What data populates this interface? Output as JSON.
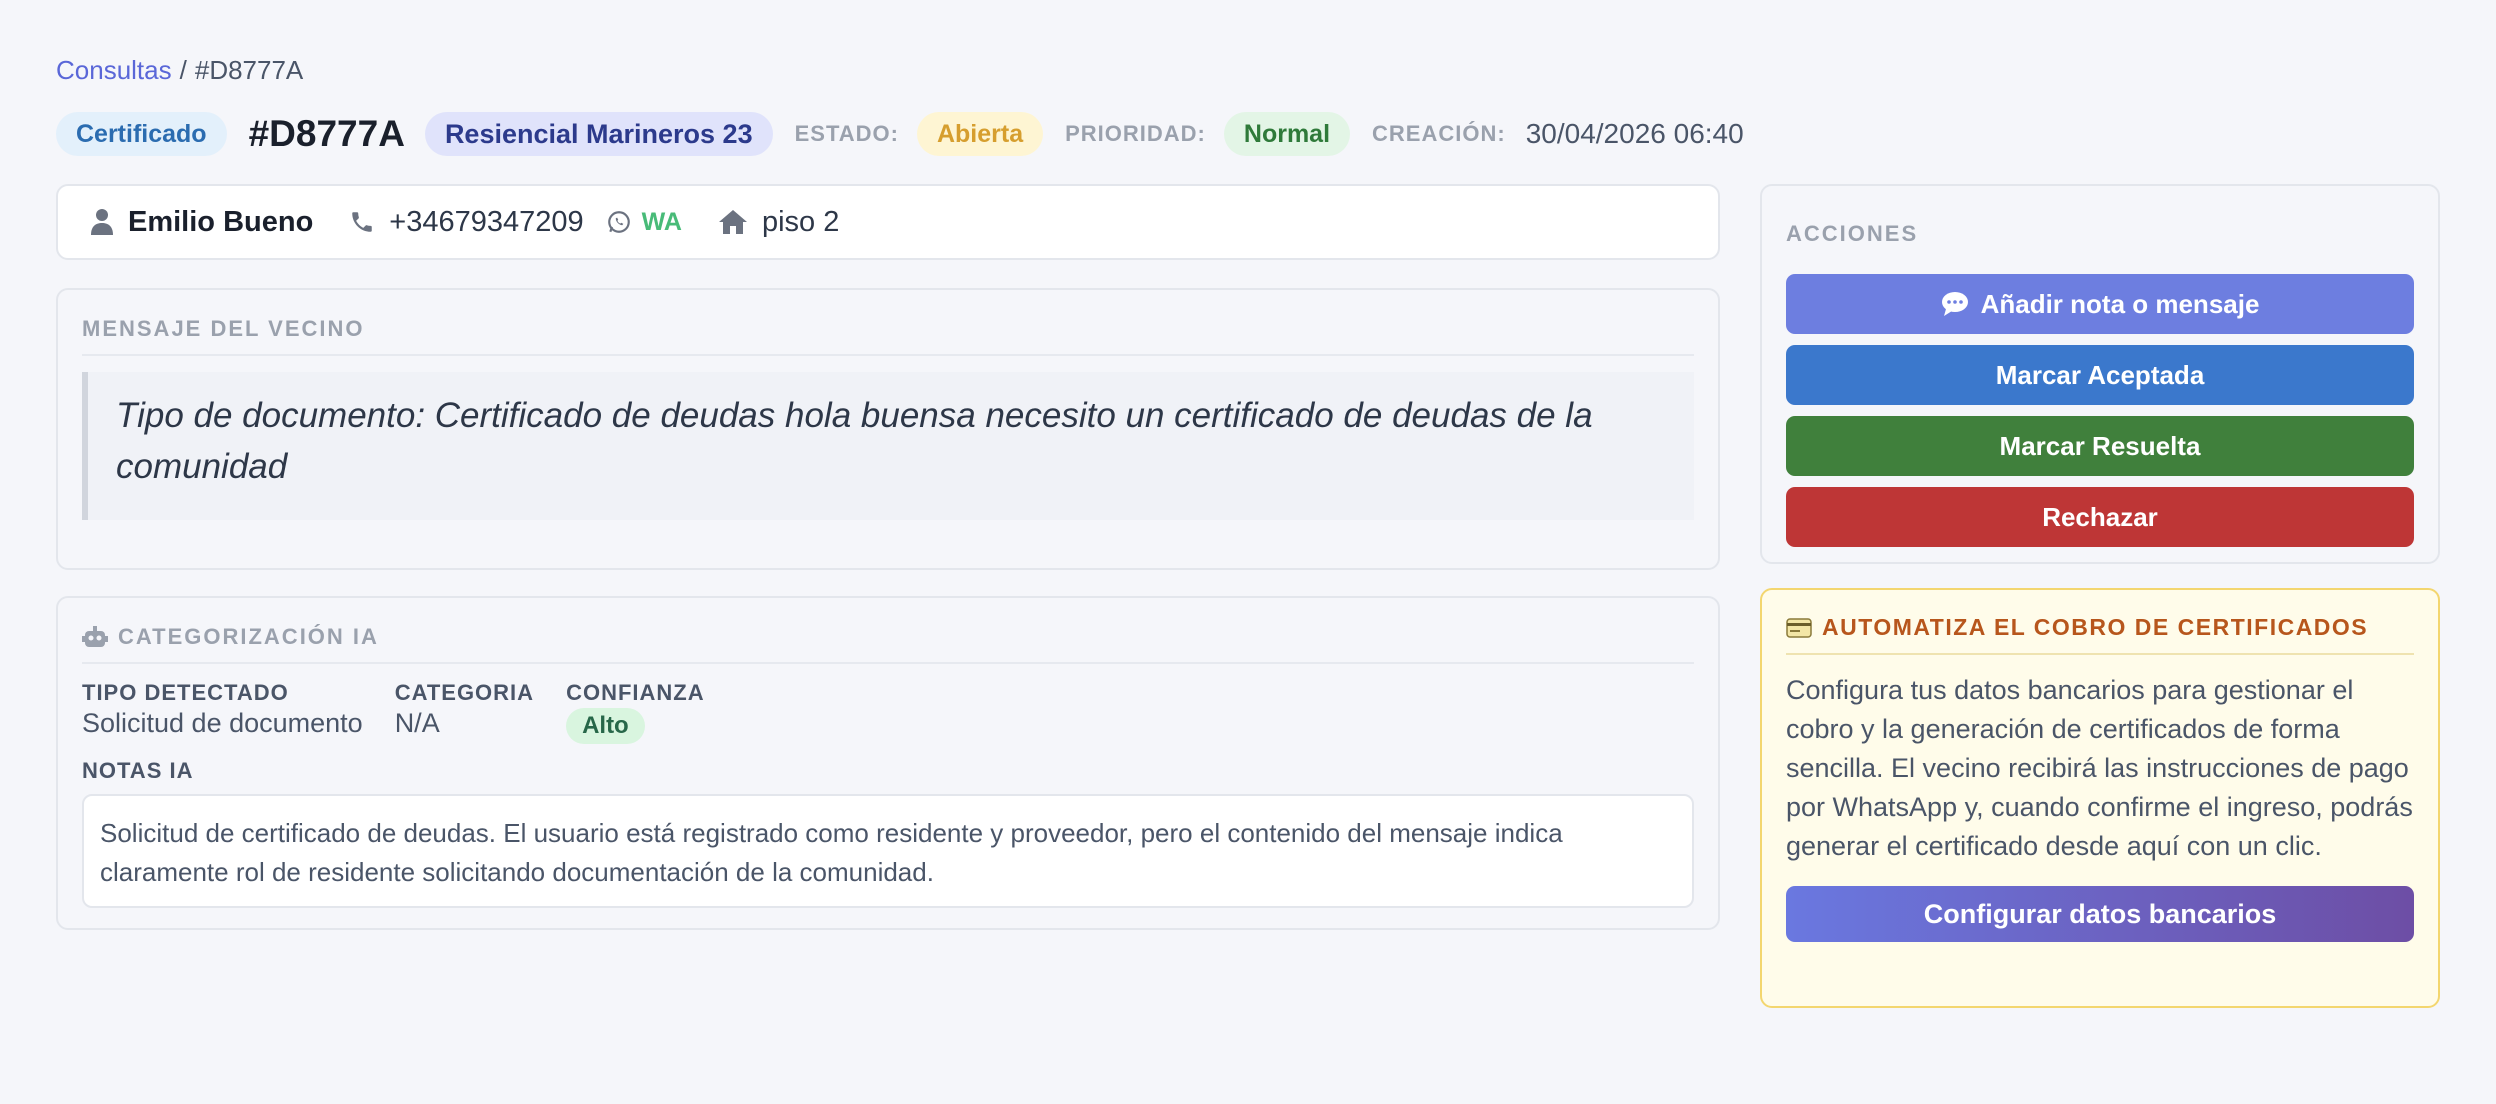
{
  "breadcrumb": {
    "parent": "Consultas",
    "separator": "/",
    "current": "#D8777A"
  },
  "header": {
    "type_badge": "Certificado",
    "ticket_id": "#D8777A",
    "community": "Resiencial Marineros 23",
    "status_label": "ESTADO:",
    "status_value": "Abierta",
    "priority_label": "PRIORIDAD:",
    "priority_value": "Normal",
    "created_label": "CREACIÓN:",
    "created_value": "30/04/2026 06:40"
  },
  "contact": {
    "name": "Emilio Bueno",
    "phone": "+34679347209",
    "whatsapp_label": "WA",
    "unit": "piso 2"
  },
  "message": {
    "title": "MENSAJE DEL VECINO",
    "text": "Tipo de documento: Certificado de deudas hola buensa necesito un certificado de deudas de la comunidad"
  },
  "ai": {
    "title": "CATEGORIZACIÓN IA",
    "detected_type_label": "TIPO DETECTADO",
    "detected_type_value": "Solicitud de documento",
    "category_label": "CATEGORIA",
    "category_value": "N/A",
    "confidence_label": "CONFIANZA",
    "confidence_value": "Alto",
    "notes_label": "NOTAS IA",
    "notes_text": "Solicitud de certificado de deudas. El usuario está registrado como residente y proveedor, pero el contenido del mensaje indica claramente rol de residente solicitando documentación de la comunidad."
  },
  "actions": {
    "title": "ACCIONES",
    "add_note": "Añadir nota o mensaje",
    "mark_accepted": "Marcar Aceptada",
    "mark_resolved": "Marcar Resuelta",
    "reject": "Rechazar"
  },
  "promo": {
    "title": "AUTOMATIZA EL COBRO DE CERTIFICADOS",
    "text": "Configura tus datos bancarios para gestionar el cobro y la generación de certificados de forma sencilla. El vecino recibirá las instrucciones de pago por WhatsApp y, cuando confirme el ingreso, podrás generar el certificado desde aquí con un clic.",
    "button": "Configurar datos bancarios"
  },
  "colors": {
    "accent": "#5a67d8",
    "status_open": "#d69e2e",
    "priority_normal": "#2f7a3a",
    "accept": "#3b78cc",
    "resolve": "#40803c",
    "reject": "#be3636",
    "whatsapp": "#48bb78"
  }
}
